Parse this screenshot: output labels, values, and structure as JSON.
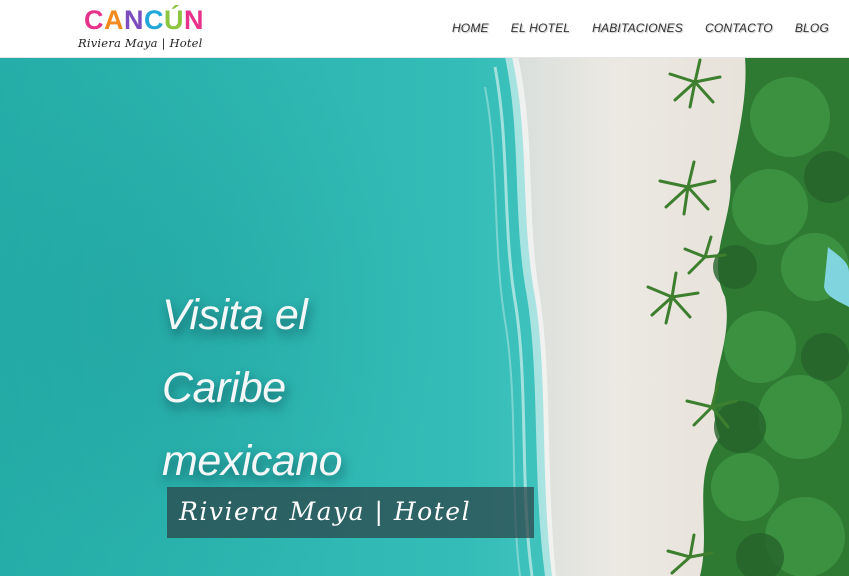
{
  "brand": {
    "word_letters": [
      {
        "char": "C",
        "color": "#e8318a"
      },
      {
        "char": "A",
        "color": "#f28a1e"
      },
      {
        "char": "N",
        "color": "#7c4dbf"
      },
      {
        "char": "C",
        "color": "#21a7d8"
      },
      {
        "char": "Ú",
        "color": "#8cc63f"
      },
      {
        "char": "N",
        "color": "#e8318a"
      }
    ],
    "subtitle": "Riviera Maya | Hotel"
  },
  "nav": {
    "items": [
      "HOME",
      "EL HOTEL",
      "HABITACIONES",
      "CONTACTO",
      "BLOG"
    ]
  },
  "hero": {
    "title_lines": [
      "Visita el",
      "Caribe",
      "mexicano"
    ],
    "tagline": "Riviera Maya | Hotel",
    "background": "aerial-beach-photo"
  },
  "colors": {
    "sea": "#2bb5b0",
    "sand": "#e9e6e0",
    "foliage": "#2f7a33",
    "nav_text": "#333333"
  }
}
